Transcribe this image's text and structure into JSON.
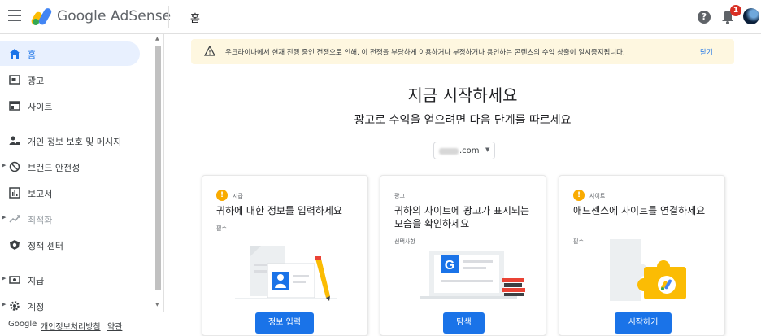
{
  "header": {
    "brand": "Google AdSense",
    "page_title": "홈",
    "help_symbol": "?",
    "notification_count": "1"
  },
  "sidebar": {
    "items": [
      {
        "label": "홈",
        "icon": "home-icon",
        "active": true
      },
      {
        "label": "광고",
        "icon": "ads-icon"
      },
      {
        "label": "사이트",
        "icon": "sites-icon"
      },
      {
        "label": "개인 정보 보호 및 메시지",
        "icon": "privacy-messaging-icon"
      },
      {
        "label": "브랜드 안전성",
        "icon": "brand-safety-icon"
      },
      {
        "label": "보고서",
        "icon": "reports-icon"
      },
      {
        "label": "최적화",
        "icon": "optimization-icon",
        "disabled": true
      },
      {
        "label": "정책 센터",
        "icon": "policy-center-icon"
      },
      {
        "label": "지급",
        "icon": "payments-icon"
      },
      {
        "label": "계정",
        "icon": "account-gear-icon"
      }
    ],
    "footer": {
      "google": "Google",
      "privacy": "개인정보처리방침",
      "terms": "약관"
    }
  },
  "banner": {
    "message": "우크라이나에서 현재 진행 중인 전쟁으로 인해, 이 전쟁을 부당하게 이용하거나 부정하거나 용인하는 콘텐츠의 수익 창출이 일시중지됩니다.",
    "close": "닫기"
  },
  "main": {
    "headline": "지금 시작하세요",
    "subhead": "광고로 수익을 얻으려면 다음 단계를 따르세요",
    "site_domain": ".com"
  },
  "cards": [
    {
      "tag": "지급",
      "title": "귀하에 대한 정보를 입력하세요",
      "requirement": "필수",
      "button": "정보 입력"
    },
    {
      "tag": "광고",
      "title": "귀하의 사이트에 광고가 표시되는 모습을 확인하세요",
      "requirement": "선택사항",
      "button": "탐색"
    },
    {
      "tag": "사이트",
      "title": "애드센스에 사이트를 연결하세요",
      "requirement": "필수",
      "button": "시작하기"
    }
  ],
  "colors": {
    "accent": "#1a73e8",
    "warning": "#f9ab00",
    "banner_bg": "#fef7e0",
    "badge": "#d93025"
  }
}
